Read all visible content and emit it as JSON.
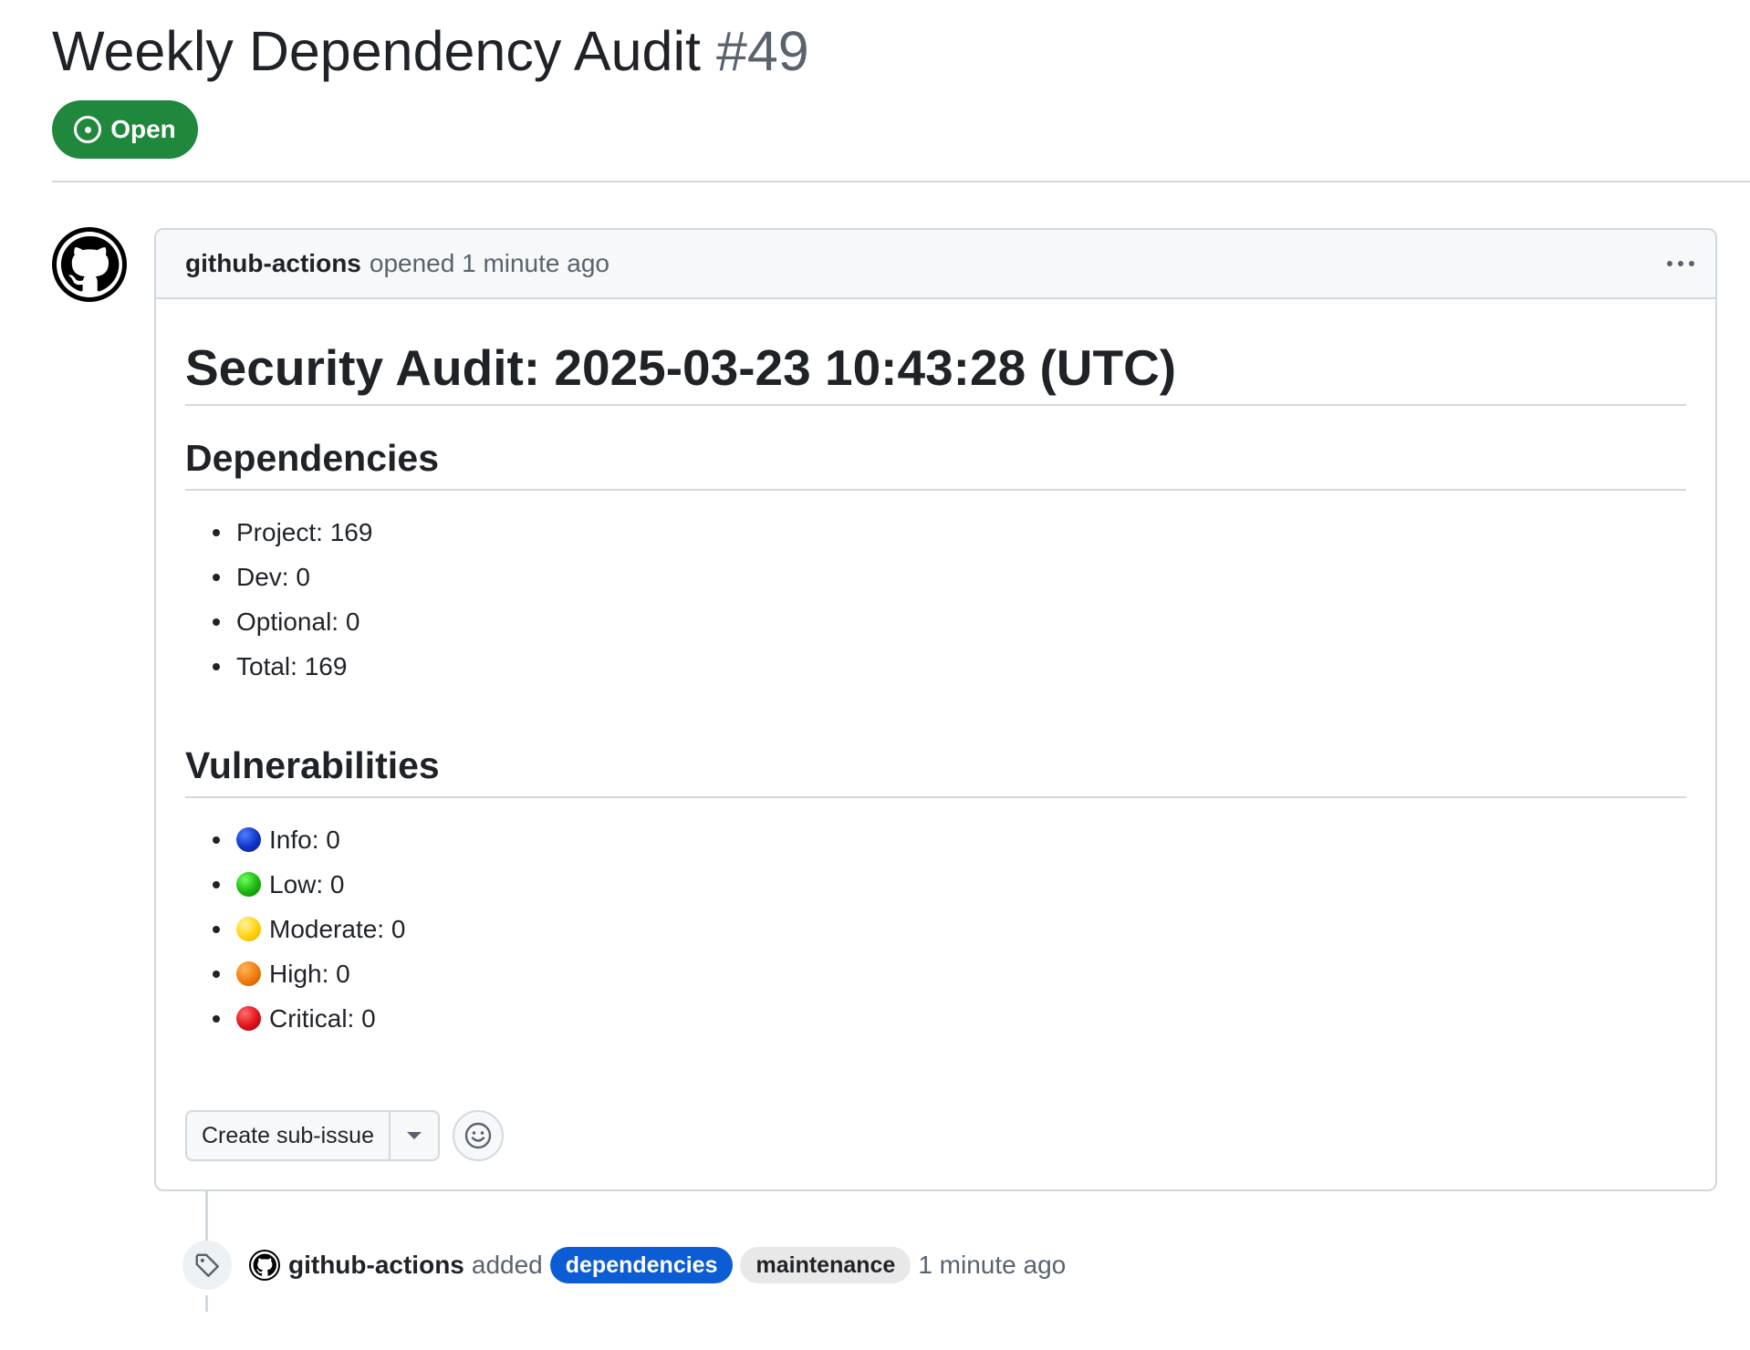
{
  "issue": {
    "title": "Weekly Dependency Audit",
    "number": "#49",
    "state": "Open"
  },
  "comment": {
    "author": "github-actions",
    "meta": "opened 1 minute ago",
    "avatar_icon": "github-mark-icon",
    "heading": "Security Audit: 2025-03-23 10:43:28 (UTC)",
    "dependencies": {
      "heading": "Dependencies",
      "items": [
        "Project: 169",
        "Dev: 0",
        "Optional: 0",
        "Total: 169"
      ]
    },
    "vulnerabilities": {
      "heading": "Vulnerabilities",
      "items": [
        {
          "label": "Info: 0",
          "color": "#1033c7"
        },
        {
          "label": "Low: 0",
          "color": "#19b40e"
        },
        {
          "label": "Moderate: 0",
          "color": "#ffd20a"
        },
        {
          "label": "High: 0",
          "color": "#f07a0a"
        },
        {
          "label": "Critical: 0",
          "color": "#e0101a"
        }
      ]
    },
    "actions": {
      "create_sub_issue": "Create sub-issue"
    }
  },
  "timeline": {
    "event_icon": "tag-icon",
    "author": "github-actions",
    "verb": "added",
    "labels": [
      {
        "name": "dependencies",
        "bg": "#0b5cd5",
        "fg": "#ffffff"
      },
      {
        "name": "maintenance",
        "bg": "#e8e8e8",
        "fg": "#1f2328"
      }
    ],
    "time": "1 minute ago"
  },
  "colors": {
    "open_green": "#1f883d",
    "border": "#d1d9e0",
    "muted_text": "#59636e"
  }
}
